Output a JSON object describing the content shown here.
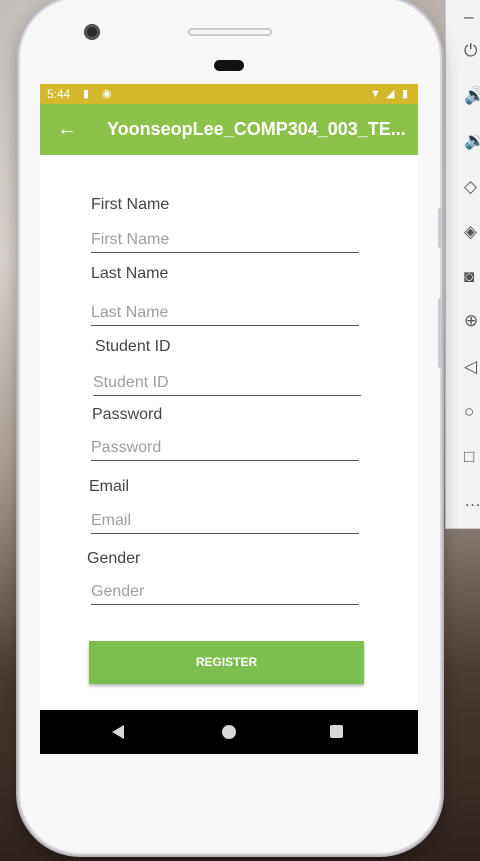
{
  "status_bar": {
    "time": "5:44",
    "sd_card_icon": "sd-card-icon",
    "sync_icon": "sync-icon",
    "wifi_icon": "wifi-icon",
    "signal_icon": "signal-icon",
    "battery_icon": "battery-icon",
    "color": "#d4b72a"
  },
  "app_bar": {
    "title": "YoonseopLee_COMP304_003_TE...",
    "back_icon": "arrow-back-icon",
    "color": "#8bc34a"
  },
  "form": {
    "first_name": {
      "label": "First Name",
      "placeholder": "First Name"
    },
    "last_name": {
      "label": "Last Name",
      "placeholder": "Last Name"
    },
    "student_id": {
      "label": "Student ID",
      "placeholder": "Student ID"
    },
    "password": {
      "label": "Password",
      "placeholder": "Password"
    },
    "email": {
      "label": "Email",
      "placeholder": "Email"
    },
    "gender": {
      "label": "Gender",
      "placeholder": "Gender"
    },
    "register_button": "REGISTER",
    "button_color": "#7cbf4f"
  },
  "nav_bar": {
    "back": "nav-back-icon",
    "home": "nav-home-icon",
    "recents": "nav-recents-icon"
  },
  "emulator_toolbar": {
    "minimize": "–",
    "items": [
      "power-icon",
      "volume-up-icon",
      "volume-down-icon",
      "rotate-left-icon",
      "rotate-right-icon",
      "camera-icon",
      "zoom-icon",
      "back-icon",
      "home-icon",
      "overview-icon",
      "more-icon"
    ]
  }
}
